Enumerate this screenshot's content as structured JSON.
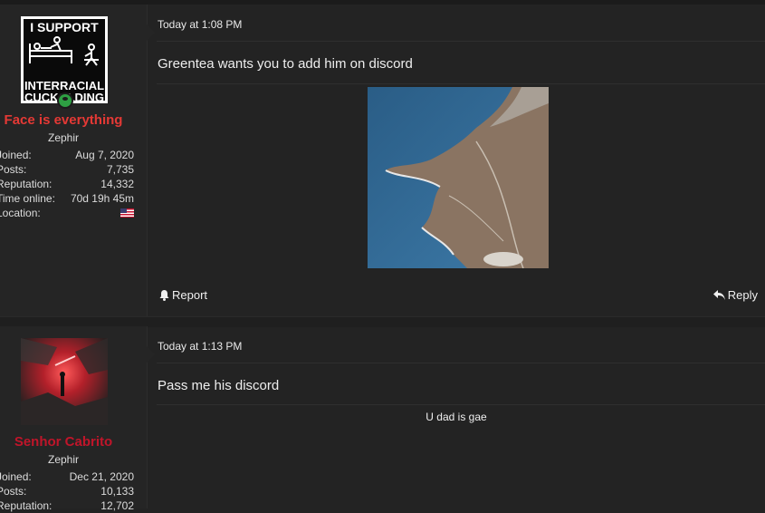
{
  "posts": [
    {
      "user": {
        "name": "Face is everything",
        "name_color": "#e53935",
        "title": "Zephir",
        "avatar_text_top": "I SUPPORT",
        "avatar_text_bottom1": "INTERRACIAL",
        "avatar_text_bottom2": "CUCKOLDING",
        "online": true,
        "stats": [
          {
            "label": "Joined:",
            "value": "Aug 7, 2020"
          },
          {
            "label": "Posts:",
            "value": "7,735"
          },
          {
            "label": "Reputation:",
            "value": "14,332"
          },
          {
            "label": "Time online:",
            "value": "70d 19h 45m"
          },
          {
            "label": "Location:",
            "value": "",
            "icon": "us-flag-icon"
          }
        ]
      },
      "timestamp": "Today at 1:08 PM",
      "message": "Greentea wants you to add him on discord",
      "attachment": "coastline-aerial-image",
      "actions": {
        "report": "Report",
        "reply": "Reply"
      }
    },
    {
      "user": {
        "name": "Senhor Cabrito",
        "name_color": "#c0152a",
        "title": "Zephir",
        "stats": [
          {
            "label": "Joined:",
            "value": "Dec 21, 2020"
          },
          {
            "label": "Posts:",
            "value": "10,133"
          },
          {
            "label": "Reputation:",
            "value": "12,702"
          }
        ]
      },
      "timestamp": "Today at 1:13 PM",
      "message": "Pass me his discord",
      "signature": "U dad is gae"
    }
  ]
}
